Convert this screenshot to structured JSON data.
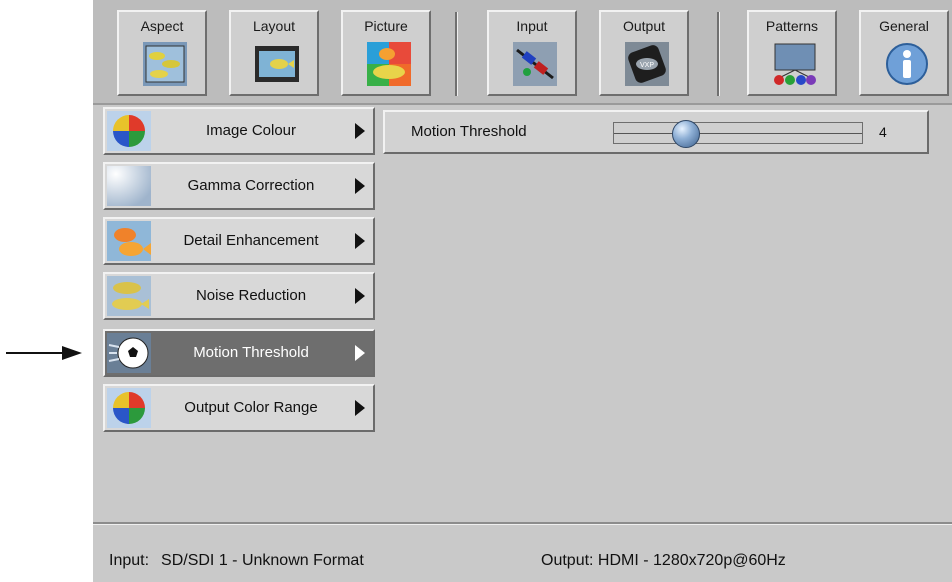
{
  "toolbar": {
    "buttons": [
      {
        "label": "Aspect",
        "icon": "aspect-icon"
      },
      {
        "label": "Layout",
        "icon": "layout-icon"
      },
      {
        "label": "Picture",
        "icon": "picture-icon"
      },
      {
        "label": "Input",
        "icon": "input-connector-icon"
      },
      {
        "label": "Output",
        "icon": "output-vxp-icon"
      },
      {
        "label": "Patterns",
        "icon": "patterns-icon"
      },
      {
        "label": "General",
        "icon": "info-icon"
      }
    ]
  },
  "menu": {
    "items": [
      {
        "label": "Image Colour",
        "icon": "color-wheel-icon",
        "active": false
      },
      {
        "label": "Gamma Correction",
        "icon": "gamma-light-icon",
        "active": false
      },
      {
        "label": "Detail Enhancement",
        "icon": "fish-detail-icon",
        "active": false
      },
      {
        "label": "Noise Reduction",
        "icon": "fish-noise-icon",
        "active": false
      },
      {
        "label": "Motion Threshold",
        "icon": "soccer-ball-icon",
        "active": true
      },
      {
        "label": "Output Color Range",
        "icon": "color-range-icon",
        "active": false
      }
    ]
  },
  "param": {
    "label": "Motion Threshold",
    "value": "4",
    "slider_fraction": 0.29
  },
  "status": {
    "input_label": "Input:",
    "input_value": "SD/SDI 1 - Unknown Format",
    "output_text": "Output: HDMI - 1280x720p@60Hz"
  },
  "colors": {
    "panel": "#c9c9c9",
    "active_item": "#6e6e6e",
    "knob": "#8fb0d6"
  }
}
